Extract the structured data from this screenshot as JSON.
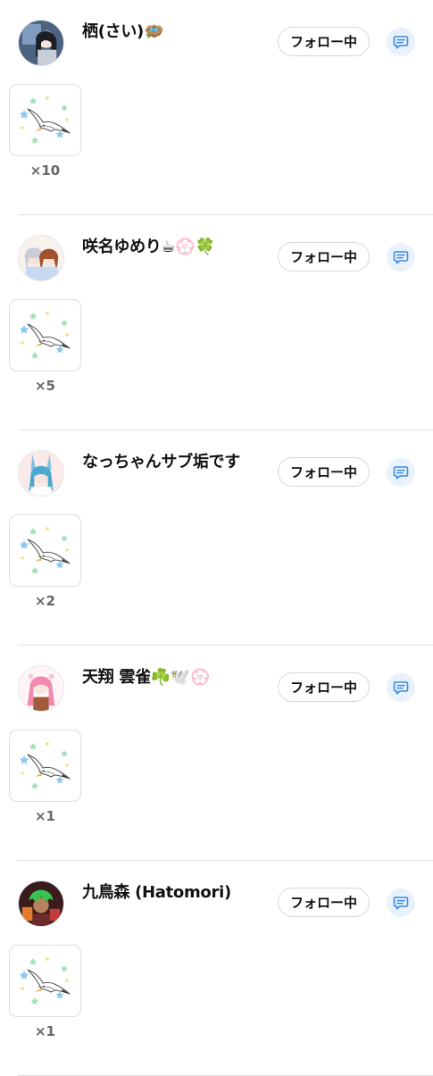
{
  "follow_label": "フォロー中",
  "entries": [
    {
      "name": "栖(さい)🪺",
      "count": "×10",
      "avatar_icon": "user-avatar-dark-hair"
    },
    {
      "name": "咲名ゆめり☕💮🍀",
      "count": "×5",
      "avatar_icon": "user-avatar-two-girls"
    },
    {
      "name": "なっちゃんサブ垢です",
      "count": "×2",
      "avatar_icon": "user-avatar-bunny-ears"
    },
    {
      "name": "天翔 雲雀☘️🕊️💮",
      "count": "×1",
      "avatar_icon": "user-avatar-pink-hair"
    },
    {
      "name": "九鳥森 (Hatomori)",
      "count": "×1",
      "avatar_icon": "user-avatar-green-hair"
    }
  ],
  "gift_icon": "seagull-stars-icon",
  "message_icon": "chat-bubble-icon",
  "colors": {
    "message_bg": "#e9f1fa",
    "message_icon": "#3b8be0",
    "divider": "#e2e2e2"
  }
}
